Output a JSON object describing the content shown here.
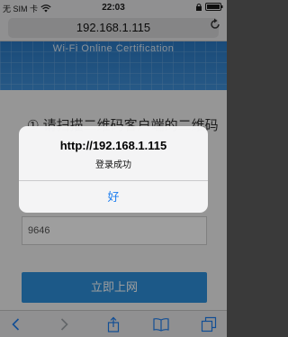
{
  "status_bar": {
    "carrier": "无 SIM 卡",
    "time": "22:03",
    "icons": [
      "wifi-icon",
      "lock-icon",
      "battery-icon"
    ]
  },
  "browser": {
    "url": "192.168.1.115",
    "reload_icon": "reload-icon",
    "toolbar_icons": [
      "back-icon",
      "forward-icon",
      "share-icon",
      "bookmarks-icon",
      "tabs-icon"
    ]
  },
  "page": {
    "hero_title": "Wi-Fi Online Certification",
    "step_text": "① 请扫描二维码客户端的二维码",
    "code_value": "9646",
    "submit_label": "立即上网",
    "colors": {
      "hero": "#2a79c4",
      "button": "#2e90db"
    }
  },
  "alert": {
    "title": "http://192.168.1.115",
    "message": "登录成功",
    "button": "好",
    "colors": {
      "button_text": "#1d7ef0"
    }
  }
}
